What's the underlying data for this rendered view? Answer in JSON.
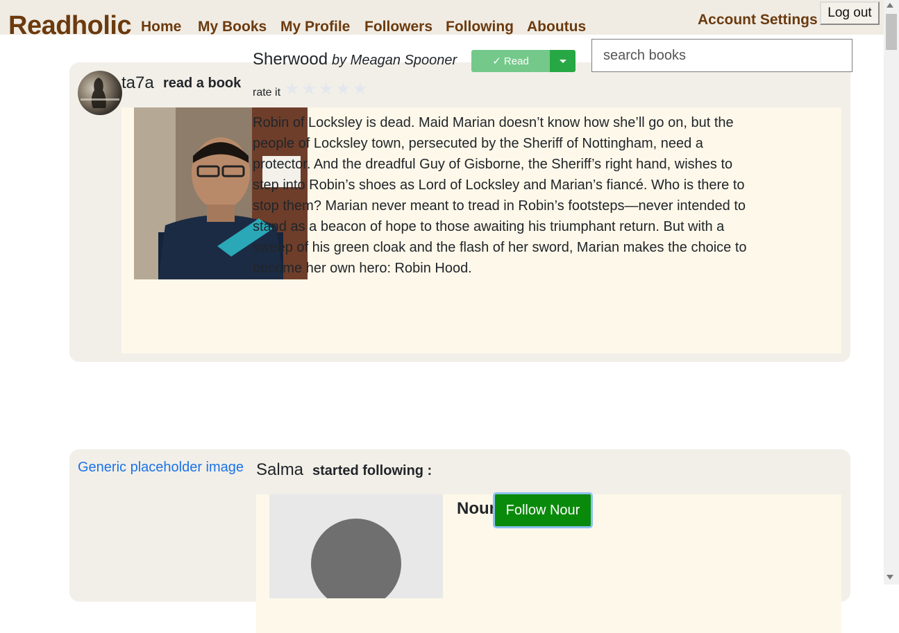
{
  "nav": {
    "brand": "Readholic",
    "links": [
      "Home",
      "My Books",
      "My Profile",
      "Followers",
      "Following",
      "Aboutus"
    ],
    "account": "Account Settings",
    "logout": "Log out"
  },
  "search": {
    "placeholder": "search books"
  },
  "feed": [
    {
      "user": "ta7a",
      "activity": "read a book",
      "book": {
        "title": "Sherwood",
        "author": "by Meagan Spooner",
        "status_label": "✓ Read",
        "rate_label": "rate it",
        "stars": [
          "★",
          "★",
          "★",
          "★",
          "★"
        ],
        "rating": 0,
        "description": "Robin of Locksley is dead. Maid Marian doesn’t know how she’ll go on, but the people of Locksley town, persecuted by the Sheriff of Nottingham, need a protector. And the dreadful Guy of Gisborne, the Sheriff’s right hand, wishes to step into Robin’s shoes as Lord of Locksley and Marian’s fiancé. Who is there to stop them? Marian never meant to tread in Robin’s footsteps—never intended to stand as a beacon of hope to those awaiting his triumphant return. But with a sweep of his green cloak and the flash of her sword, Marian makes the choice to become her own hero: Robin Hood."
      }
    },
    {
      "user": "Salma",
      "avatar_alt": "Generic placeholder image",
      "activity": "started following :",
      "target": "Nour",
      "follow_label": "Follow Nour"
    }
  ],
  "colors": {
    "brand": "#6b3a0e",
    "navbar_bg": "#f0ece4",
    "card_bg": "#f2efe8",
    "inner_bg": "#fdf8ea",
    "read_button": "#74c98a",
    "follow_button": "#0a8a0a"
  }
}
